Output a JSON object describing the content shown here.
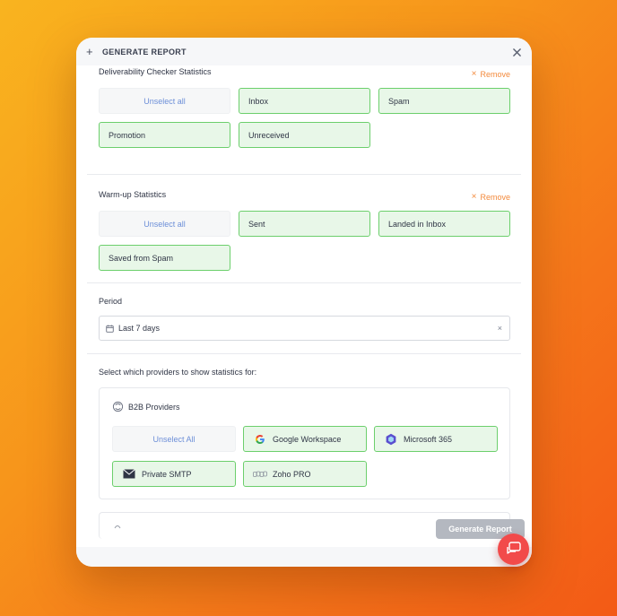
{
  "header": {
    "title": "GENERATE REPORT",
    "plus": "+"
  },
  "deliverability": {
    "title": "Deliverability Checker Statistics",
    "remove_label": "Remove",
    "chips": [
      {
        "label": "Unselect all",
        "selected": false
      },
      {
        "label": "Inbox",
        "selected": true
      },
      {
        "label": "Spam",
        "selected": true
      },
      {
        "label": "Promotion",
        "selected": true
      },
      {
        "label": "Unreceived",
        "selected": true
      }
    ]
  },
  "warmup": {
    "title": "Warm-up Statistics",
    "remove_label": "Remove",
    "chips": [
      {
        "label": "Unselect all",
        "selected": false
      },
      {
        "label": "Sent",
        "selected": true
      },
      {
        "label": "Landed in Inbox",
        "selected": true
      },
      {
        "label": "Saved from Spam",
        "selected": true
      }
    ]
  },
  "period": {
    "label": "Period",
    "value": "Last 7 days",
    "clear": "×"
  },
  "providers": {
    "prompt": "Select which providers to show statistics for:",
    "group_title": "B2B Providers",
    "chips": [
      {
        "label": "Unselect All",
        "selected": false,
        "icon": ""
      },
      {
        "label": "Google Workspace",
        "selected": true,
        "icon": "google-icon"
      },
      {
        "label": "Microsoft 365",
        "selected": true,
        "icon": "microsoft-365-icon"
      },
      {
        "label": "Private SMTP",
        "selected": true,
        "icon": "envelope-icon"
      },
      {
        "label": "Zoho PRO",
        "selected": true,
        "icon": "zoho-icon"
      }
    ]
  },
  "footer": {
    "generate_label": "Generate Report"
  },
  "colors": {
    "accent_orange": "#f38a3c",
    "chip_border": "#6ccf6c",
    "chip_bg": "#e8f7e8",
    "link_blue": "#6d8fd8",
    "chat_red": "#f24a4a"
  }
}
